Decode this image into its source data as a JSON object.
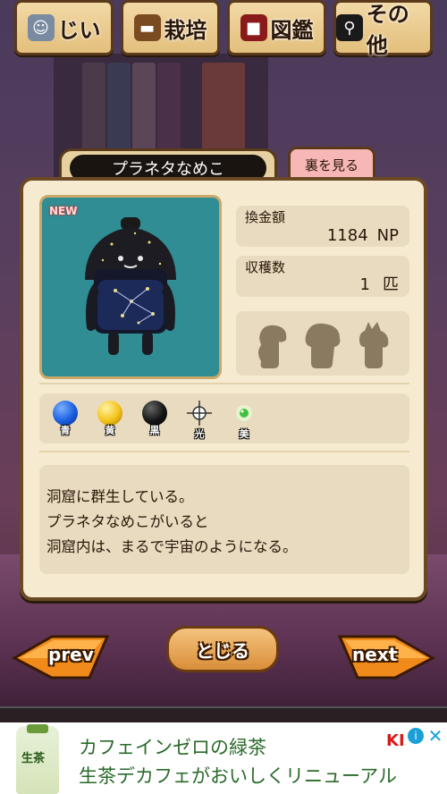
{
  "tabs": [
    {
      "label": "じい",
      "icon": "grandpa-icon"
    },
    {
      "label": "栽培",
      "icon": "log-icon"
    },
    {
      "label": "図鑑",
      "icon": "book-icon"
    },
    {
      "label": "その他",
      "icon": "magnifier-icon"
    }
  ],
  "card": {
    "name": "プラネタなめこ",
    "back_button": "裏を見る",
    "new_badge": "NEW",
    "exchange_label": "換金額",
    "exchange_value": "1184",
    "exchange_unit": "NP",
    "harvest_label": "収穫数",
    "harvest_value": "1",
    "harvest_unit": "匹",
    "attributes": [
      {
        "label": "青",
        "color": "#1a5fe0"
      },
      {
        "label": "黄",
        "color": "#f4c21a"
      },
      {
        "label": "黒",
        "color": "#151515"
      },
      {
        "label": "光",
        "color": "#ffffff"
      },
      {
        "label": "美",
        "color": "#3ec23e"
      }
    ],
    "description": [
      "洞窟に群生している。",
      "プラネタなめこがいると",
      "洞窟内は、まるで宇宙のようになる。"
    ]
  },
  "nav": {
    "prev": "prev",
    "close": "とじる",
    "next": "next"
  },
  "ad": {
    "line1": "カフェインゼロの緑茶",
    "line2": "生茶デカフェがおいしくリニューアル",
    "brand": "KI",
    "bottle_text": "生茶"
  }
}
